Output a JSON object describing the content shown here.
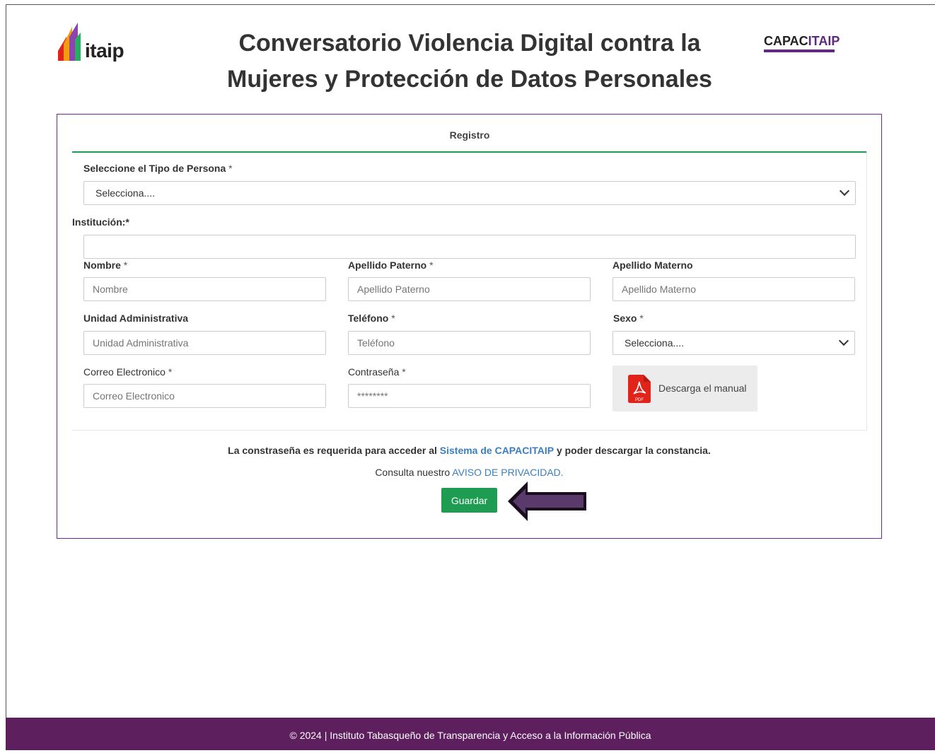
{
  "header": {
    "logo_left_text": "itaip",
    "title_line1": "Conversatorio Violencia Digital contra la",
    "title_line2": "Mujeres y Protección de Datos Personales",
    "logo_right_text_a": "CAPAC",
    "logo_right_text_b": "ITAIP"
  },
  "form": {
    "header": "Registro",
    "tipo_persona": {
      "label": "Seleccione el Tipo de Persona",
      "required": "*",
      "value": "Selecciona...."
    },
    "institucion": {
      "label": "Institución:*",
      "value": ""
    },
    "nombre": {
      "label": "Nombre",
      "required": "*",
      "placeholder": "Nombre"
    },
    "apellido_paterno": {
      "label": "Apellido Paterno",
      "required": "*",
      "placeholder": "Apellido Paterno"
    },
    "apellido_materno": {
      "label": "Apellido Materno",
      "placeholder": "Apellido Materno"
    },
    "unidad_administrativa": {
      "label": "Unidad Administrativa",
      "placeholder": "Unidad Administrativa"
    },
    "telefono": {
      "label": "Teléfono",
      "required": "*",
      "placeholder": "Teléfono"
    },
    "sexo": {
      "label": "Sexo",
      "required": "*",
      "value": "Selecciona...."
    },
    "correo": {
      "label": "Correo Electronico",
      "required": "*",
      "placeholder": "Correo Electronico"
    },
    "contrasena": {
      "label": "Contraseña",
      "required": "*",
      "placeholder": "********"
    },
    "manual_button": "Descarga el manual",
    "manual_icon_text": "PDF"
  },
  "notice": {
    "line1_pre": "La constraseña es requerida para acceder al",
    "line1_link": "Sistema de CAPACITAIP",
    "line1_post": "y poder descargar la constancia.",
    "line2_pre": "Consulta nuestro",
    "line2_link": "AVISO DE PRIVACIDAD."
  },
  "submit_label": "Guardar",
  "footer_text": "© 2024 | Instituto Tabasqueño de Transparencia y Acceso a la Información Pública",
  "colors": {
    "accent_purple": "#5e1f5e",
    "border_purple": "#6a2c8e",
    "button_green": "#1e9c52",
    "link_blue": "#3a7fc1",
    "pdf_red": "#e2231a"
  }
}
